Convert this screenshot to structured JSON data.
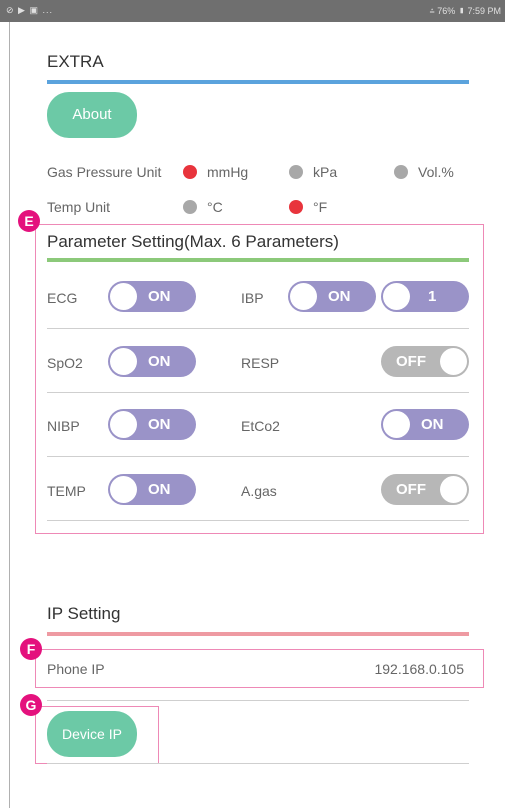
{
  "status_bar": {
    "left_icons": "⊘ ▶ ▣ ...",
    "right_text": "⩮ 76% ▮ 7:59 PM"
  },
  "extra": {
    "title": "EXTRA",
    "about_button": "About"
  },
  "gas_pressure": {
    "label": "Gas Pressure Unit",
    "options": [
      "mmHg",
      "kPa",
      "Vol.%"
    ],
    "selected": "mmHg"
  },
  "temp_unit": {
    "label": "Temp Unit",
    "options": [
      "°C",
      "°F"
    ],
    "selected": "°F"
  },
  "parameter_setting": {
    "title": "Parameter Setting(Max. 6 Parameters)",
    "rows": [
      {
        "left": {
          "label": "ECG",
          "state": "ON"
        },
        "right": {
          "label": "IBP",
          "state": "ON",
          "channel": "1"
        }
      },
      {
        "left": {
          "label": "SpO2",
          "state": "ON"
        },
        "right": {
          "label": "RESP",
          "state": "OFF"
        }
      },
      {
        "left": {
          "label": "NIBP",
          "state": "ON"
        },
        "right": {
          "label": "EtCo2",
          "state": "ON"
        }
      },
      {
        "left": {
          "label": "TEMP",
          "state": "ON"
        },
        "right": {
          "label": "A.gas",
          "state": "OFF"
        }
      }
    ]
  },
  "ip_setting": {
    "title": "IP Setting",
    "phone_ip_label": "Phone IP",
    "phone_ip_value": "192.168.0.105",
    "device_ip_button": "Device IP"
  },
  "markers": {
    "e": "E",
    "f": "F",
    "g": "G"
  },
  "colors": {
    "accent_blue": "#5ba3dd",
    "accent_green": "#8cc97a",
    "accent_red": "#ee9aa2",
    "toggle_on": "#9a93c8",
    "toggle_off": "#b7b7b7",
    "button_green": "#6cc9a6",
    "callout_pink": "#e4117d"
  }
}
